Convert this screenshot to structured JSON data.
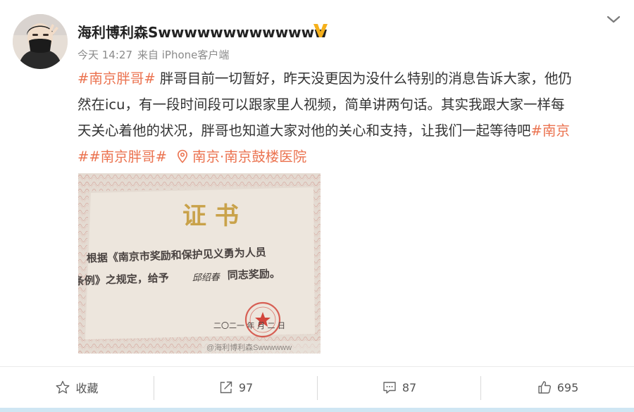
{
  "user": {
    "name": "海利博利森Swwwwwwwwwwwww"
  },
  "meta": {
    "time": "今天 14:27",
    "source": "来自 iPhone客户端"
  },
  "content": {
    "line1_tag": "#南京胖哥#",
    "line1_text": " 胖哥目前一切暂好，昨天没更因为没什么特别的消息告诉大家，他仍",
    "line2_text": "然在icu，有一段时间段可以跟家里人视频，简单讲两句话。其实我跟大家一样每",
    "line3_text": "天关心着他的状况，胖哥也知道大家对他的关心和支持，让我们一起等待吧",
    "line3_tag": "#南京",
    "line4_tag": "##南京胖哥#",
    "location": "南京·南京鼓楼医院"
  },
  "photo": {
    "title": "证 书",
    "line1": "根据《南京市奖励和保护见义勇为人员",
    "line2": "条例》之规定，给予",
    "recipient": "邱绍春",
    "line2_end": " 同志奖励。",
    "date": "二〇二一 年  月  二 日",
    "watermark": "@海利博利森Swwwwww"
  },
  "actions": {
    "favorite_label": "收藏",
    "repost_count": "97",
    "comment_count": "87",
    "like_count": "695"
  },
  "colors": {
    "accent": "#eb7350",
    "verified": "#f5b01b"
  },
  "icons": {
    "verified": "verified-v-icon",
    "location": "location-pin-icon",
    "favorite": "star-icon",
    "repost": "repost-icon",
    "comment": "comment-icon",
    "like": "thumbs-up-icon",
    "more": "chevron-down-icon"
  }
}
